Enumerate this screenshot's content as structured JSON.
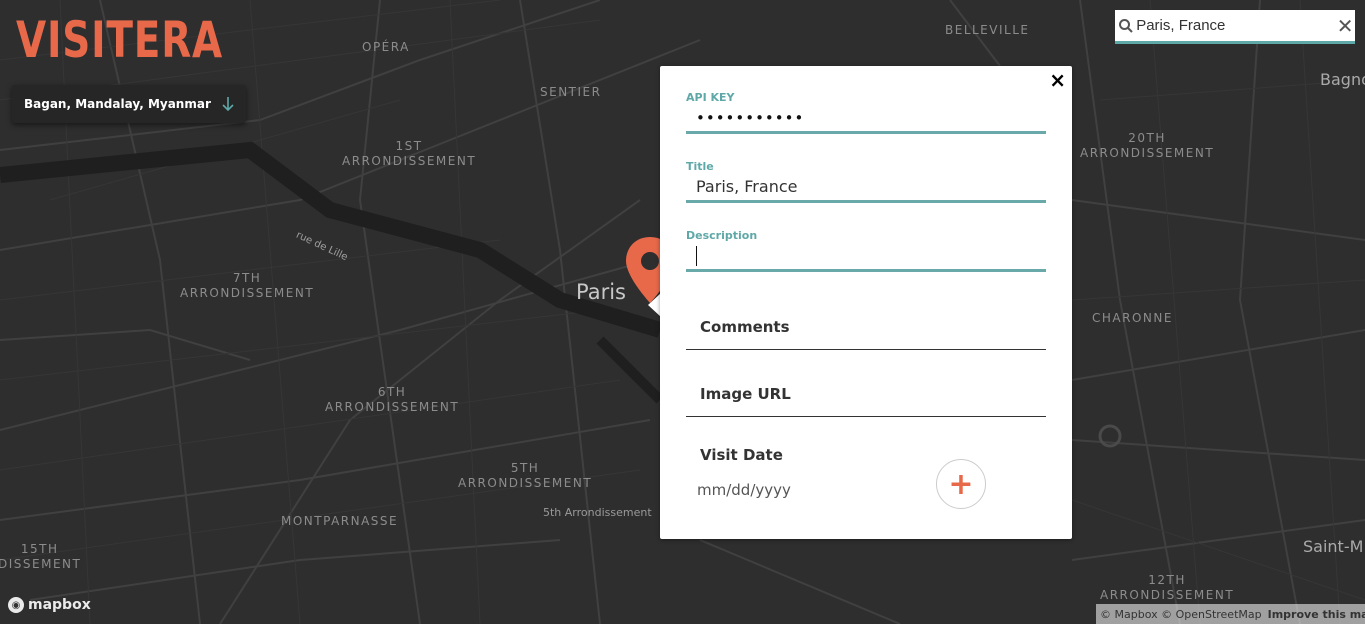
{
  "app": {
    "logo_text": "VISITERA"
  },
  "place_select": {
    "selected": "Bagan, Mandalay, Myanmar"
  },
  "search": {
    "value": "Paris, France",
    "clear_label": "✕"
  },
  "map": {
    "city_label": "Paris",
    "labels": [
      {
        "id": "opera",
        "text": "OPÉRA"
      },
      {
        "id": "sentier",
        "text": "SENTIER"
      },
      {
        "id": "belleville",
        "text": "BELLEVILLE"
      },
      {
        "id": "bagno",
        "text": "Bagno"
      },
      {
        "id": "arr1",
        "text": "1ST\nARRONDISSEMENT"
      },
      {
        "id": "arr20",
        "text": "20TH\nARRONDISSEMENT"
      },
      {
        "id": "arr7",
        "text": "7TH\nARRONDISSEMENT"
      },
      {
        "id": "charonne",
        "text": "CHARONNE"
      },
      {
        "id": "arr6",
        "text": "6TH\nARRONDISSEMENT"
      },
      {
        "id": "arr5",
        "text": "5TH\nARRONDISSEMENT"
      },
      {
        "id": "arr5b",
        "text": "5th Arrondissement"
      },
      {
        "id": "montparnasse",
        "text": "MONTPARNASSE"
      },
      {
        "id": "arr15",
        "text": "15TH\nDISSEMENT"
      },
      {
        "id": "arr12",
        "text": "12TH\nARRONDISSEMENT"
      },
      {
        "id": "saintm",
        "text": "Saint-M"
      },
      {
        "id": "rue",
        "text": "rue de Lille"
      }
    ],
    "mapbox_label": "mapbox",
    "attribution": "© Mapbox © OpenStreetMap",
    "improve_label": "Improve this map"
  },
  "popup": {
    "close_label": "×",
    "api_key": {
      "label": "API KEY",
      "value": "•••••••••••"
    },
    "title": {
      "label": "Title",
      "value": "Paris, France"
    },
    "description": {
      "label": "Description",
      "value": ""
    },
    "comments_placeholder": "Comments",
    "image_url_placeholder": "Image URL",
    "visit_date_label": "Visit Date",
    "date_placeholder": "mm/dd/yyyy",
    "add_label": "+"
  },
  "colors": {
    "accent": "#e8694a",
    "teal": "#5fa8a8",
    "map_bg": "#2e2e2e"
  }
}
